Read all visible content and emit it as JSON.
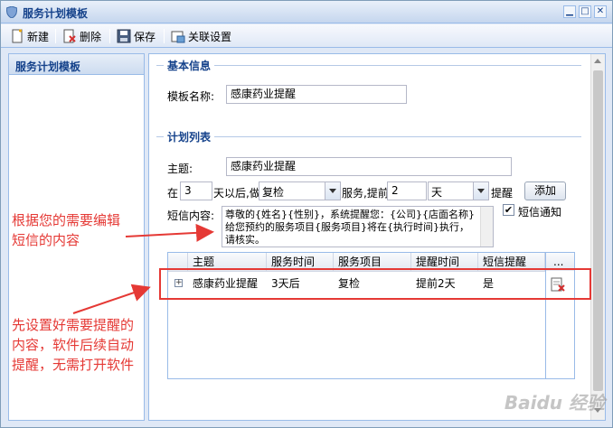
{
  "window": {
    "title": "服务计划模板",
    "min": "▁",
    "max": "□",
    "close": "✕"
  },
  "toolbar": {
    "new_label": "新建",
    "delete_label": "删除",
    "save_label": "保存",
    "link_label": "关联设置"
  },
  "left_panel": {
    "title": "服务计划模板"
  },
  "basic_info": {
    "legend": "基本信息",
    "name_label": "模板名称:",
    "name_value": "感康药业提醒"
  },
  "plan_list": {
    "legend": "计划列表",
    "subject_label": "主题:",
    "subject_value": "感康药业提醒",
    "in_label": "在",
    "days_value": "3",
    "after_label": "天以后,做",
    "service_value": "复检",
    "service_label": "服务,提前",
    "remind_value": "2",
    "unit_value": "天",
    "remind_label": "提醒",
    "add_button": "添加",
    "sms_label": "短信内容:",
    "sms_value": "尊敬的{姓名}{性别}，系统提醒您：{公司}{店面名称}给您预约的服务项目{服务项目}将在{执行时间}执行，请核实。",
    "sms_notify_label": "短信通知",
    "sms_notify_checked": "✔"
  },
  "grid": {
    "columns": [
      "主题",
      "服务时间",
      "服务项目",
      "提醒时间",
      "短信提醒",
      "..."
    ],
    "rows": [
      {
        "expander": "+",
        "subject": "感康药业提醒",
        "service_time": "3天后",
        "service_item": "复检",
        "remind_time": "提前2天",
        "sms": "是"
      }
    ]
  },
  "annotations": {
    "note1_line1": "根据您的需要编辑",
    "note1_line2": "短信的内容",
    "note2_line1": "先设置好需要提醒的",
    "note2_line2": "内容，软件后续自动",
    "note2_line3": "提醒，无需打开软件"
  },
  "watermark": "Baidu 经验",
  "colors": {
    "accent": "#15428b",
    "annotation": "#e53935",
    "border": "#99bbe8"
  }
}
